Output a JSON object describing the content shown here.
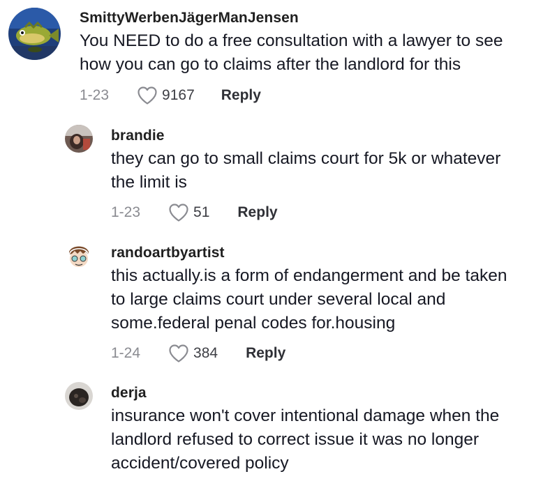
{
  "comments": [
    {
      "username": "SmittyWerbenJägerManJensen",
      "lines": [
        "You NEED to do a free consultation with a lawyer to see",
        "how you can go to claims after the landlord for this"
      ],
      "date": "1-23",
      "likes": "9167",
      "reply_label": "Reply",
      "avatar_icon": "fish-avatar-icon"
    },
    {
      "username": "brandie",
      "lines": [
        "they can go to small claims court for 5k or whatever",
        "the limit is"
      ],
      "date": "1-23",
      "likes": "51",
      "reply_label": "Reply",
      "avatar_icon": "photo-avatar-icon"
    },
    {
      "username": "randoartbyartist",
      "lines": [
        "this actually.is a form of endangerment and be taken",
        "to large claims court under several local and",
        "some.federal penal codes for.housing"
      ],
      "date": "1-24",
      "likes": "384",
      "reply_label": "Reply",
      "avatar_icon": "cartoon-avatar-icon"
    },
    {
      "username": "derja",
      "lines": [
        "insurance won't cover intentional damage when the",
        "landlord refused to correct issue it was no longer",
        "accident/covered policy"
      ]
    }
  ],
  "colors": {
    "text": "#161823",
    "muted": "#8a8b91",
    "like_count": "#3d3e44"
  },
  "icons": {
    "like": "heart-outline-icon"
  }
}
